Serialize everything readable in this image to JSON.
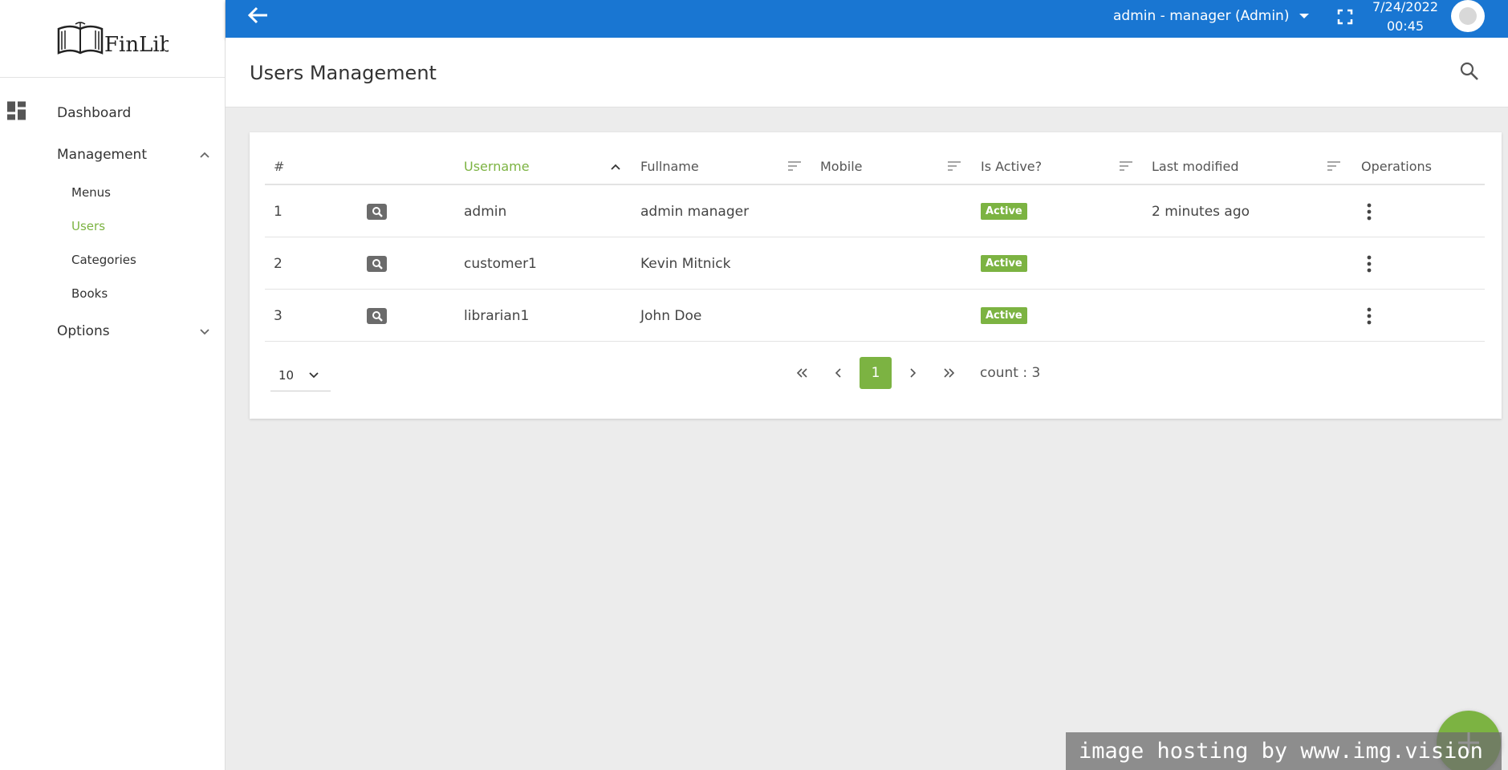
{
  "sidebar": {
    "logo_text": "FinLib",
    "items": [
      {
        "label": "Dashboard"
      },
      {
        "label": "Management"
      },
      {
        "label": "Options"
      }
    ],
    "sub_items": [
      {
        "label": "Menus"
      },
      {
        "label": "Users",
        "active": true
      },
      {
        "label": "Categories"
      },
      {
        "label": "Books"
      }
    ]
  },
  "topbar": {
    "user_label": "admin - manager (Admin)",
    "date": "7/24/2022",
    "time": "00:45"
  },
  "page": {
    "title": "Users Management"
  },
  "table": {
    "columns": [
      {
        "label": "#"
      },
      {
        "label": ""
      },
      {
        "label": "Username"
      },
      {
        "label": "Fullname"
      },
      {
        "label": "Mobile"
      },
      {
        "label": "Is Active?"
      },
      {
        "label": "Last modified"
      },
      {
        "label": "Operations"
      }
    ],
    "rows": [
      {
        "num": "1",
        "username": "admin",
        "fullname": "admin manager",
        "mobile": "",
        "status": "Active",
        "modified": "2 minutes ago"
      },
      {
        "num": "2",
        "username": "customer1",
        "fullname": "Kevin Mitnick",
        "mobile": "",
        "status": "Active",
        "modified": ""
      },
      {
        "num": "3",
        "username": "librarian1",
        "fullname": "John Doe",
        "mobile": "",
        "status": "Active",
        "modified": ""
      }
    ]
  },
  "pagination": {
    "page_size": "10",
    "current_page": "1",
    "count_label": "count : 3"
  },
  "watermark": "image hosting by www.img.vision",
  "colors": {
    "primary": "#1976d2",
    "accent": "#7cb342"
  },
  "icons": {
    "back": "arrow-left-icon",
    "dropdown": "caret-down-icon",
    "fullscreen": "fullscreen-icon",
    "search": "search-icon",
    "dashboard": "dashboard-grid-icon",
    "sort": "sort-lines-icon",
    "view": "magnifier-icon",
    "operations": "kebab-icon",
    "add": "plus-icon"
  }
}
